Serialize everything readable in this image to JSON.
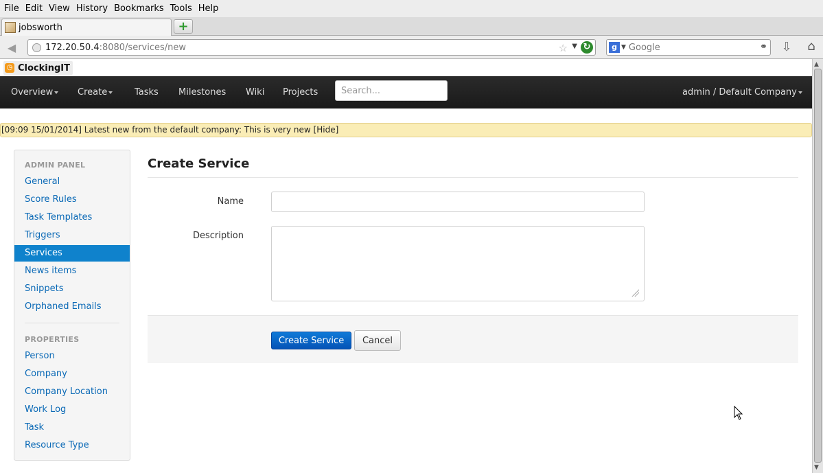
{
  "browser": {
    "menu": [
      "File",
      "Edit",
      "View",
      "History",
      "Bookmarks",
      "Tools",
      "Help"
    ],
    "menu_underline_index": [
      0,
      0,
      0,
      2,
      0,
      0,
      0
    ],
    "tab_title": "jobsworth",
    "url_host": "172.20.50.4",
    "url_path": ":8080/services/new",
    "search_placeholder": "Google",
    "icons": {
      "back": "back-arrow-icon",
      "new_tab": "plus-icon",
      "bookmark": "star-icon",
      "reload": "reload-icon",
      "search_engine": "google-icon",
      "search_go": "binoculars-icon",
      "downloads": "download-arrow-icon",
      "home": "home-icon"
    }
  },
  "app": {
    "logo_text": "ClockingIT",
    "nav": {
      "overview": "Overview",
      "create": "Create",
      "tasks": "Tasks",
      "milestones": "Milestones",
      "wiki": "Wiki",
      "projects": "Projects",
      "search_placeholder": "Search...",
      "user": "admin / Default Company"
    },
    "news": {
      "text": "[09:09 15/01/2014] Latest new from the default company: This is very new ",
      "hide": "[Hide]"
    },
    "sidebar": {
      "admin_header": "ADMIN PANEL",
      "admin_items": [
        "General",
        "Score Rules",
        "Task Templates",
        "Triggers",
        "Services",
        "News items",
        "Snippets",
        "Orphaned Emails"
      ],
      "active_item": "Services",
      "properties_header": "PROPERTIES",
      "property_items": [
        "Person",
        "Company",
        "Company Location",
        "Work Log",
        "Task",
        "Resource Type"
      ]
    },
    "form": {
      "title": "Create Service",
      "name_label": "Name",
      "name_value": "",
      "description_label": "Description",
      "description_value": "",
      "submit_label": "Create Service",
      "cancel_label": "Cancel"
    },
    "colors": {
      "accent": "#0f82cc",
      "link": "#0a69b6",
      "navbar": "#1f1f1f",
      "news_bg": "#faedb6",
      "primary_button": "#0a66c8"
    }
  }
}
